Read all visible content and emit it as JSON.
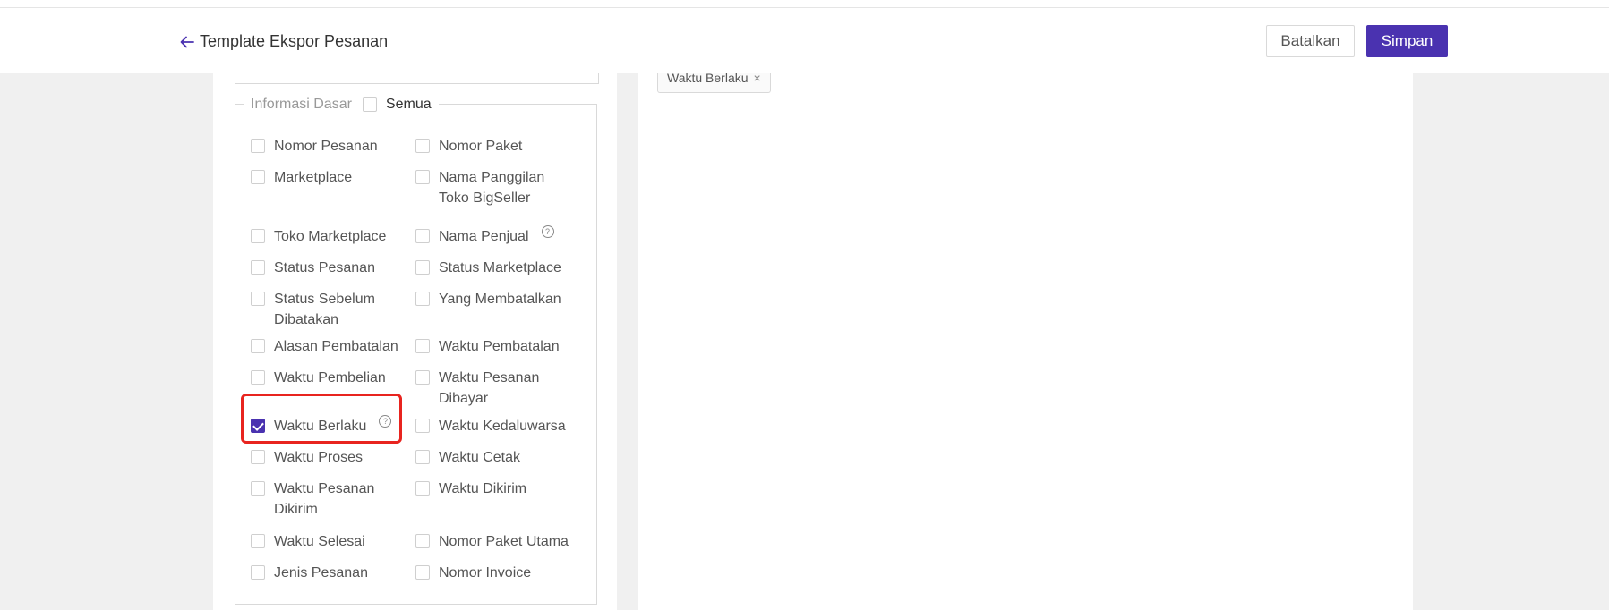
{
  "header": {
    "title": "Template Ekspor Pesanan",
    "cancel_label": "Batalkan",
    "save_label": "Simpan"
  },
  "section": {
    "title": "Informasi Dasar",
    "select_all_label": "Semua",
    "select_all_checked": false
  },
  "options": [
    {
      "label": "Nomor Pesanan",
      "checked": false,
      "help": false
    },
    {
      "label": "Nomor Paket",
      "checked": false,
      "help": false
    },
    {
      "label": "Marketplace",
      "checked": false,
      "help": false
    },
    {
      "label": "Nama Panggilan Toko BigSeller",
      "checked": false,
      "help": false
    },
    {
      "label": "Toko Marketplace",
      "checked": false,
      "help": false
    },
    {
      "label": "Nama Penjual",
      "checked": false,
      "help": true
    },
    {
      "label": "Status Pesanan",
      "checked": false,
      "help": false
    },
    {
      "label": "Status Marketplace",
      "checked": false,
      "help": false
    },
    {
      "label": "Status Sebelum Dibatakan",
      "checked": false,
      "help": false
    },
    {
      "label": "Yang Membatalkan",
      "checked": false,
      "help": false
    },
    {
      "label": "Alasan Pembatalan",
      "checked": false,
      "help": false
    },
    {
      "label": "Waktu Pembatalan",
      "checked": false,
      "help": false
    },
    {
      "label": "Waktu Pembelian",
      "checked": false,
      "help": false
    },
    {
      "label": "Waktu Pesanan Dibayar",
      "checked": false,
      "help": false
    },
    {
      "label": "Waktu Berlaku",
      "checked": true,
      "help": true
    },
    {
      "label": "Waktu Kedaluwarsa",
      "checked": false,
      "help": false
    },
    {
      "label": "Waktu Proses",
      "checked": false,
      "help": false
    },
    {
      "label": "Waktu Cetak",
      "checked": false,
      "help": false
    },
    {
      "label": "Waktu Pesanan Dikirim",
      "checked": false,
      "help": false
    },
    {
      "label": "Waktu Dikirim",
      "checked": false,
      "help": false
    },
    {
      "label": "Waktu Selesai",
      "checked": false,
      "help": false
    },
    {
      "label": "Nomor Paket Utama",
      "checked": false,
      "help": false
    },
    {
      "label": "Jenis Pesanan",
      "checked": false,
      "help": false
    },
    {
      "label": "Nomor Invoice",
      "checked": false,
      "help": false
    }
  ],
  "selected_tags": [
    {
      "label": "Waktu Berlaku"
    }
  ],
  "icons": {
    "back": "arrow-left-icon",
    "help": "question-circle-icon",
    "remove": "close-icon"
  },
  "colors": {
    "primary": "#4a32b0",
    "highlight": "#e8241f"
  }
}
